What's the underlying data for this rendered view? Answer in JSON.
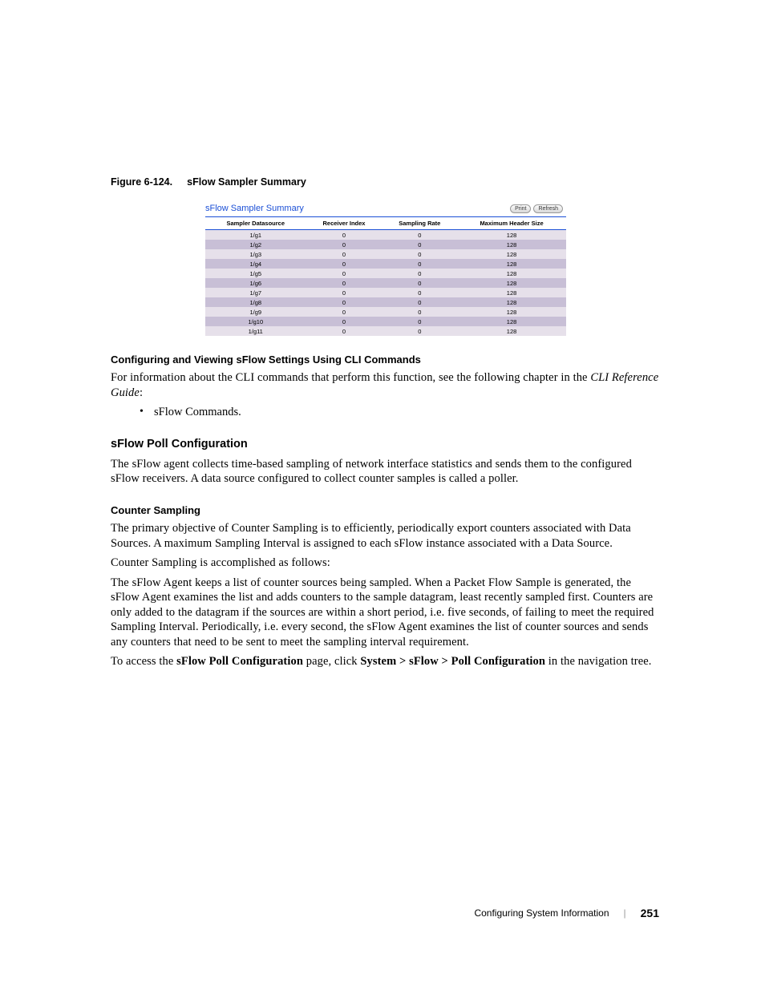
{
  "figure": {
    "number": "Figure 6-124.",
    "title": "sFlow Sampler Summary"
  },
  "screenshot": {
    "panel_title": "sFlow Sampler Summary",
    "btn_print": "Print",
    "btn_refresh": "Refresh",
    "headers": {
      "h1": "Sampler Datasource",
      "h2": "Receiver Index",
      "h3": "Sampling Rate",
      "h4": "Maximum Header Size"
    },
    "rows": [
      {
        "ds": "1/g1",
        "ri": "0",
        "sr": "0",
        "mhs": "128"
      },
      {
        "ds": "1/g2",
        "ri": "0",
        "sr": "0",
        "mhs": "128"
      },
      {
        "ds": "1/g3",
        "ri": "0",
        "sr": "0",
        "mhs": "128"
      },
      {
        "ds": "1/g4",
        "ri": "0",
        "sr": "0",
        "mhs": "128"
      },
      {
        "ds": "1/g5",
        "ri": "0",
        "sr": "0",
        "mhs": "128"
      },
      {
        "ds": "1/g6",
        "ri": "0",
        "sr": "0",
        "mhs": "128"
      },
      {
        "ds": "1/g7",
        "ri": "0",
        "sr": "0",
        "mhs": "128"
      },
      {
        "ds": "1/g8",
        "ri": "0",
        "sr": "0",
        "mhs": "128"
      },
      {
        "ds": "1/g9",
        "ri": "0",
        "sr": "0",
        "mhs": "128"
      },
      {
        "ds": "1/g10",
        "ri": "0",
        "sr": "0",
        "mhs": "128"
      },
      {
        "ds": "1/g11",
        "ri": "0",
        "sr": "0",
        "mhs": "128"
      }
    ]
  },
  "sections": {
    "cli_h": "Configuring and Viewing sFlow Settings Using CLI Commands",
    "cli_p_a": "For information about the CLI commands that perform this function, see the following chapter in the ",
    "cli_p_b": "CLI Reference Guide",
    "cli_p_c": ":",
    "cli_li": "sFlow Commands.",
    "poll_h": "sFlow Poll Configuration",
    "poll_p": "The sFlow agent collects time-based sampling of network interface statistics and sends them to the configured sFlow receivers. A data source configured to collect counter samples is called a poller.",
    "cs_h": "Counter Sampling",
    "cs_p1": "The primary objective of Counter Sampling is to efficiently, periodically export counters associated with Data Sources. A maximum Sampling Interval is assigned to each sFlow instance associated with a Data Source.",
    "cs_p2": "Counter Sampling is accomplished as follows:",
    "cs_p3": "The sFlow Agent keeps a list of counter sources being sampled. When a Packet Flow Sample is generated, the sFlow Agent examines the list and adds counters to the sample datagram, least recently sampled first. Counters are only added to the datagram if the sources are within a short period, i.e. five seconds, of failing to meet the required Sampling Interval. Periodically, i.e. every second, the sFlow Agent examines the list of counter sources and sends any counters that need to be sent to meet the sampling interval requirement.",
    "nav_a": "To access the ",
    "nav_b": "sFlow Poll Configuration",
    "nav_c": " page, click ",
    "nav_d": "System > sFlow > Poll Configuration",
    "nav_e": " in the navigation tree."
  },
  "footer": {
    "section": "Configuring System Information",
    "page": "251"
  }
}
